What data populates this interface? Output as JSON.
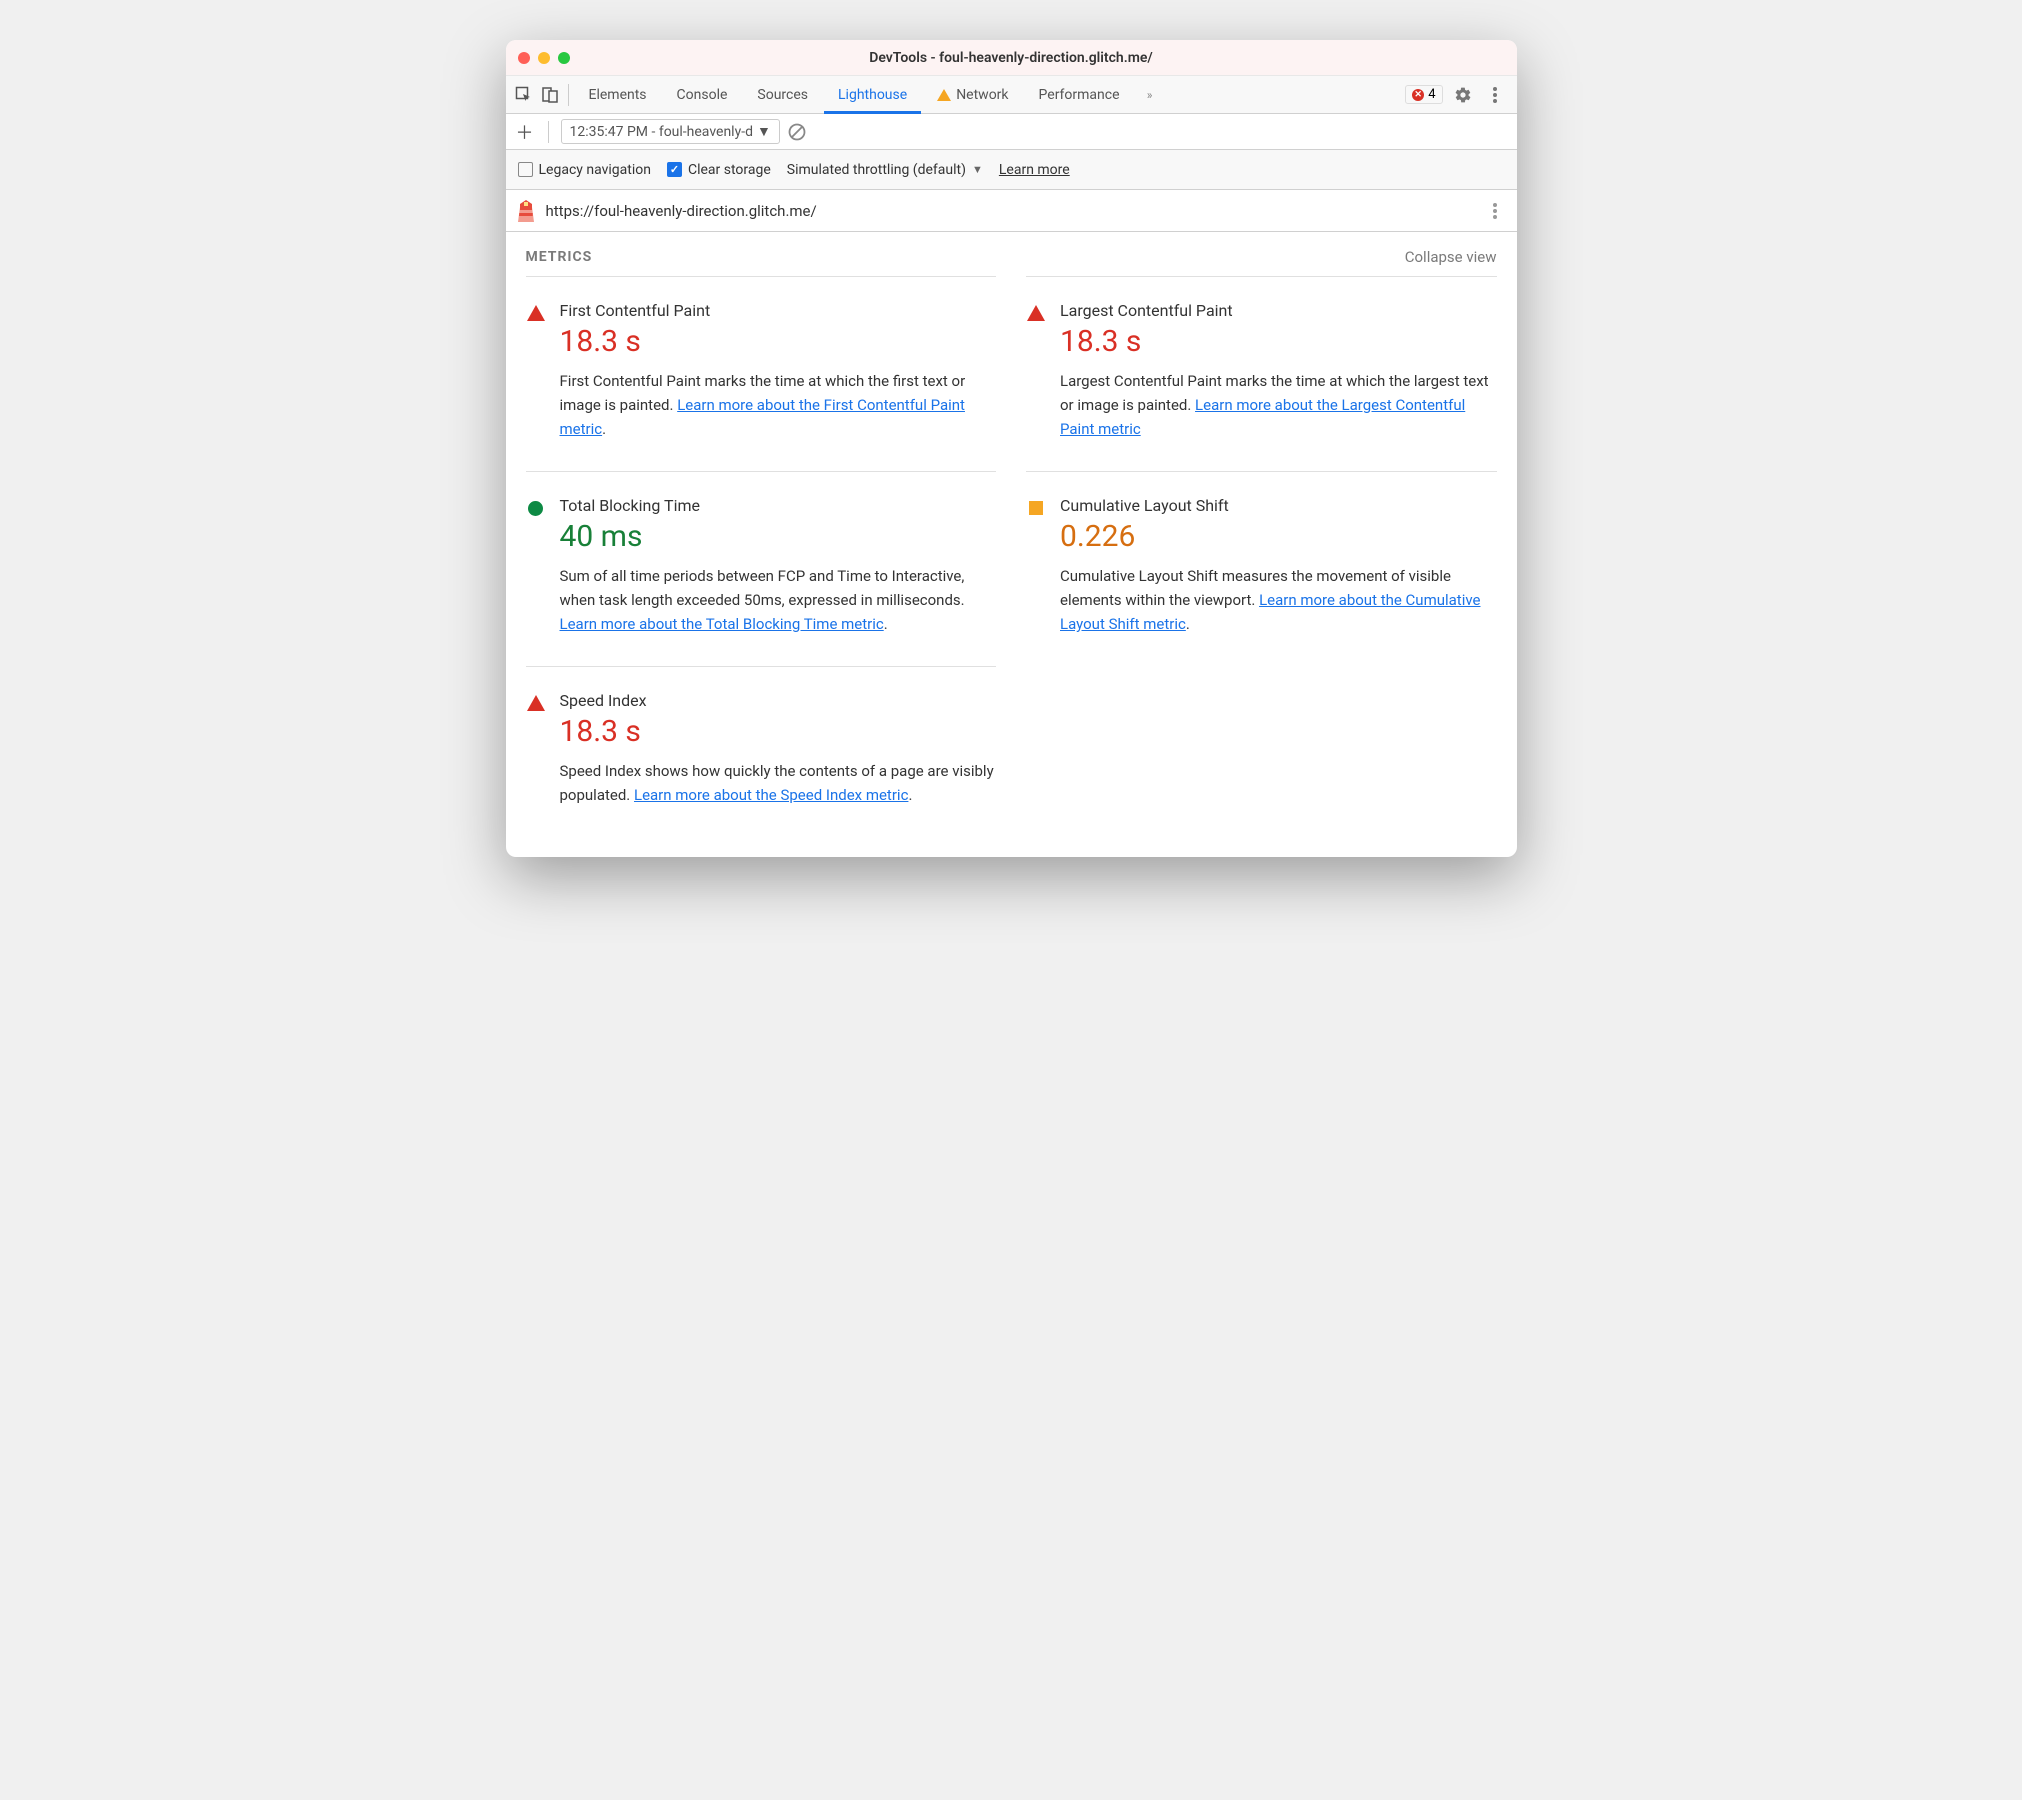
{
  "window": {
    "title": "DevTools - foul-heavenly-direction.glitch.me/"
  },
  "tabs": {
    "items": [
      "Elements",
      "Console",
      "Sources",
      "Lighthouse",
      "Network",
      "Performance"
    ],
    "active": "Lighthouse",
    "error_count": "4"
  },
  "toolbar": {
    "report": "12:35:47 PM - foul-heavenly-d"
  },
  "options": {
    "legacy": "Legacy navigation",
    "clear": "Clear storage",
    "throttle": "Simulated throttling (default)",
    "learn": "Learn more"
  },
  "url": "https://foul-heavenly-direction.glitch.me/",
  "section": {
    "title": "METRICS",
    "collapse": "Collapse view"
  },
  "metrics": [
    {
      "icon": "tri-r",
      "valClass": "r",
      "title": "First Contentful Paint",
      "value": "18.3 s",
      "desc": "First Contentful Paint marks the time at which the first text or image is painted. ",
      "link": "Learn more about the First Contentful Paint metric",
      "tail": "."
    },
    {
      "icon": "tri-r",
      "valClass": "r",
      "title": "Largest Contentful Paint",
      "value": "18.3 s",
      "desc": "Largest Contentful Paint marks the time at which the largest text or image is painted. ",
      "link": "Learn more about the Largest Contentful Paint metric",
      "tail": ""
    },
    {
      "icon": "circ-g",
      "valClass": "g",
      "title": "Total Blocking Time",
      "value": "40 ms",
      "desc": "Sum of all time periods between FCP and Time to Interactive, when task length exceeded 50ms, expressed in milliseconds. ",
      "link": "Learn more about the Total Blocking Time metric",
      "tail": "."
    },
    {
      "icon": "sq-o",
      "valClass": "o",
      "title": "Cumulative Layout Shift",
      "value": "0.226",
      "desc": "Cumulative Layout Shift measures the movement of visible elements within the viewport. ",
      "link": "Learn more about the Cumulative Layout Shift metric",
      "tail": "."
    },
    {
      "icon": "tri-r",
      "valClass": "r",
      "title": "Speed Index",
      "value": "18.3 s",
      "desc": "Speed Index shows how quickly the contents of a page are visibly populated. ",
      "link": "Learn more about the Speed Index metric",
      "tail": "."
    }
  ]
}
